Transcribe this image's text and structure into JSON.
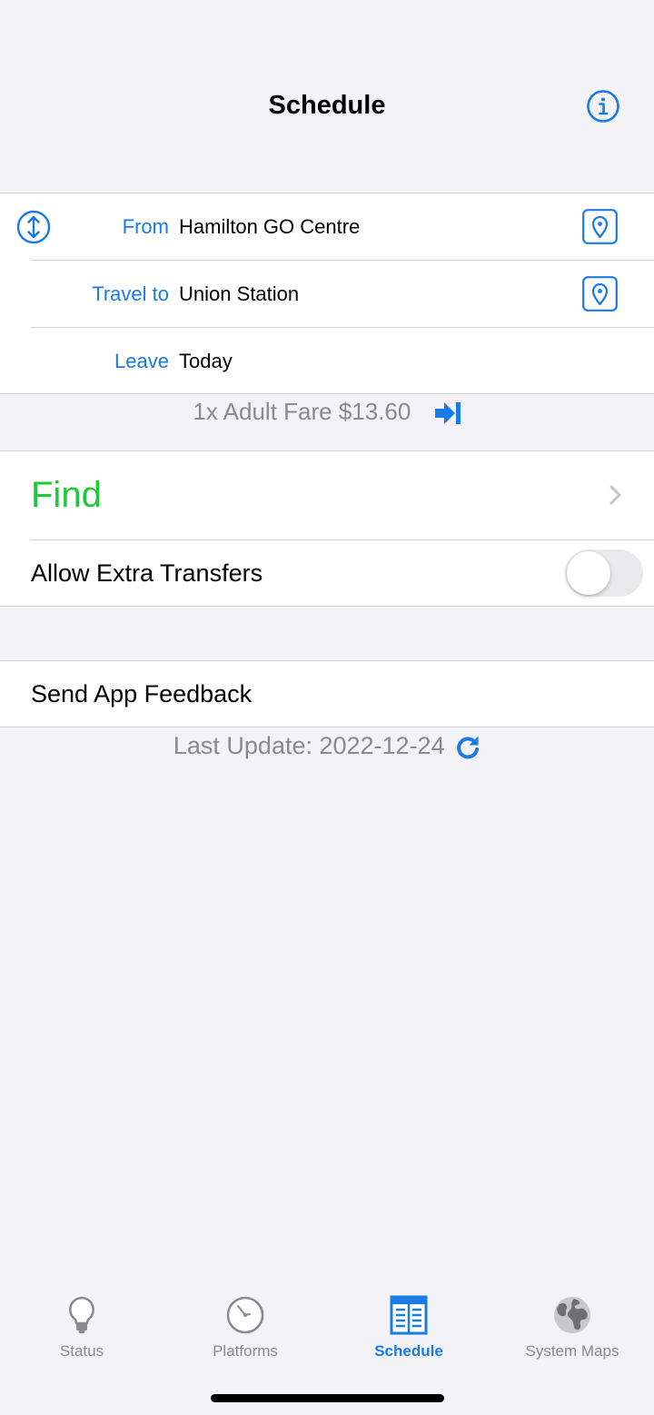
{
  "nav": {
    "title": "Schedule",
    "info_icon": "info-circle-icon"
  },
  "route": {
    "swap_icon": "swap-arrows-icon",
    "from_label": "From",
    "from_value": "Hamilton GO Centre",
    "to_label": "Travel to",
    "to_value": "Union Station",
    "leave_label": "Leave",
    "leave_value": "Today",
    "pin_icon": "map-pin-icon"
  },
  "fare": {
    "text": "1x Adult Fare $13.60",
    "icon": "arrow-to-line-right-icon"
  },
  "actions": {
    "find_label": "Find",
    "transfers_label": "Allow Extra Transfers",
    "transfers_enabled": false,
    "feedback_label": "Send App Feedback"
  },
  "update": {
    "text": "Last Update: 2022-12-24",
    "icon": "refresh-icon"
  },
  "tabs": [
    {
      "label": "Status",
      "icon": "lightbulb-icon",
      "active": false
    },
    {
      "label": "Platforms",
      "icon": "clock-icon",
      "active": false
    },
    {
      "label": "Schedule",
      "icon": "schedule-grid-icon",
      "active": true
    },
    {
      "label": "System Maps",
      "icon": "globe-icon",
      "active": false
    }
  ],
  "colors": {
    "accent": "#1a7ae6",
    "find": "#1fc73a",
    "secondary_text": "#8a8a8e",
    "background": "#f2f2f7"
  }
}
